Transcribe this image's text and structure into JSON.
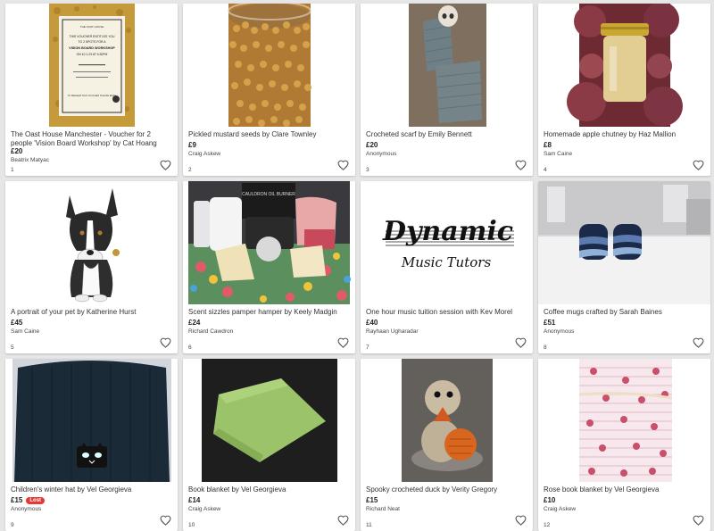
{
  "items": [
    {
      "title": "The Oast House Manchester - Voucher for 2 people 'Vision Board Workshop' by Cat Hoang",
      "price": "£20",
      "seller": "Beatrix Matyac",
      "number": "1"
    },
    {
      "title": "Pickled mustard seeds by Clare Townley",
      "price": "£9",
      "seller": "Craig Askew",
      "number": "2"
    },
    {
      "title": "Crocheted scarf by Emily Bennett",
      "price": "£20",
      "seller": "Anonymous",
      "number": "3"
    },
    {
      "title": "Homemade apple chutney by Haz Mallion",
      "price": "£8",
      "seller": "Sam Caine",
      "number": "4"
    },
    {
      "title": "A portrait of your pet by Katherine Hurst",
      "price": "£45",
      "seller": "Sam Caine",
      "number": "5"
    },
    {
      "title": "Scent sizzles pamper hamper by Keely Madgin",
      "price": "£24",
      "seller": "Richard Cawdron",
      "number": "6"
    },
    {
      "title": "One hour music tuition session with Kev Morel",
      "price": "£40",
      "seller": "Rayhaan Ugharadar",
      "number": "7"
    },
    {
      "title": "Coffee mugs crafted by Sarah Baines",
      "price": "£51",
      "seller": "Anonymous",
      "number": "8"
    },
    {
      "title": "Children's winter hat by Vel Georgieva",
      "price": "£15",
      "badge": "Lost",
      "seller": "Anonymous",
      "number": "9"
    },
    {
      "title": "Book blanket by Vel Georgieva",
      "price": "£14",
      "seller": "Craig Askew",
      "number": "10"
    },
    {
      "title": "Spooky crocheted duck by Verity Gregory",
      "price": "£15",
      "seller": "Richard Neat",
      "number": "11"
    },
    {
      "title": "Rose book blanket by Vel Georgieva",
      "price": "£10",
      "seller": "Craig Askew",
      "number": "12"
    }
  ],
  "voucher": {
    "header": "THE OAST HOUSE",
    "line1": "THIS VOUCHER ENTITLES YOU",
    "line2": "TO 2 SPOTS FOR A",
    "line3": "VISION BOARD WORKSHOP",
    "line4": "ON 10.1.23 AT 6:30PM",
    "footer": "TO REDEEM THIS VOUCHER PLEASE EMAIL"
  },
  "hamper_box_text": "CAULDRON OIL BURNER",
  "music_logo": {
    "line1": "Dynamic",
    "line2": "Music Tutors"
  },
  "icons": {
    "favorite": "heart-outline-icon"
  },
  "colors": {
    "lost_badge": "#e53935",
    "background": "#e6e6e6"
  }
}
